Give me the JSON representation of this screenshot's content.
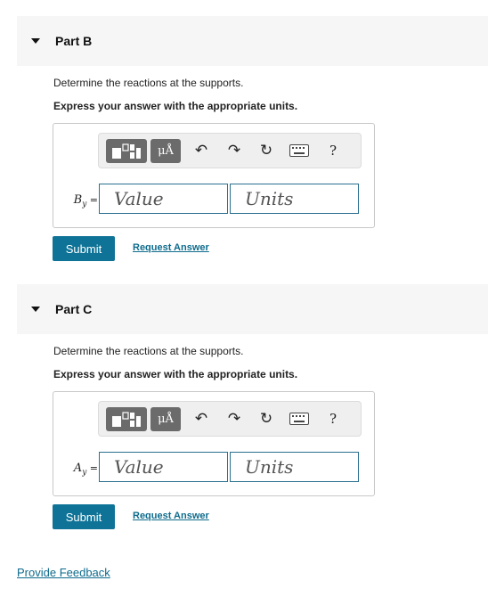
{
  "parts": [
    {
      "title": "Part B",
      "prompt": "Determine the reactions at the supports.",
      "instruction": "Express your answer with the appropriate units.",
      "variable_base": "B",
      "variable_sub": "y",
      "variable_eq": " =",
      "value_placeholder": "Value",
      "units_placeholder": "Units",
      "submit_label": "Submit",
      "request_label": "Request Answer"
    },
    {
      "title": "Part C",
      "prompt": "Determine the reactions at the supports.",
      "instruction": "Express your answer with the appropriate units.",
      "variable_base": "A",
      "variable_sub": "y",
      "variable_eq": " =",
      "value_placeholder": "Value",
      "units_placeholder": "Units",
      "submit_label": "Submit",
      "request_label": "Request Answer"
    }
  ],
  "toolbar": {
    "units_symbol": "μÅ",
    "help_symbol": "?",
    "icons": [
      "templates-icon",
      "units-icon",
      "undo-icon",
      "redo-icon",
      "reset-icon",
      "keyboard-icon",
      "help-icon"
    ]
  },
  "footer": {
    "feedback_label": "Provide Feedback"
  }
}
